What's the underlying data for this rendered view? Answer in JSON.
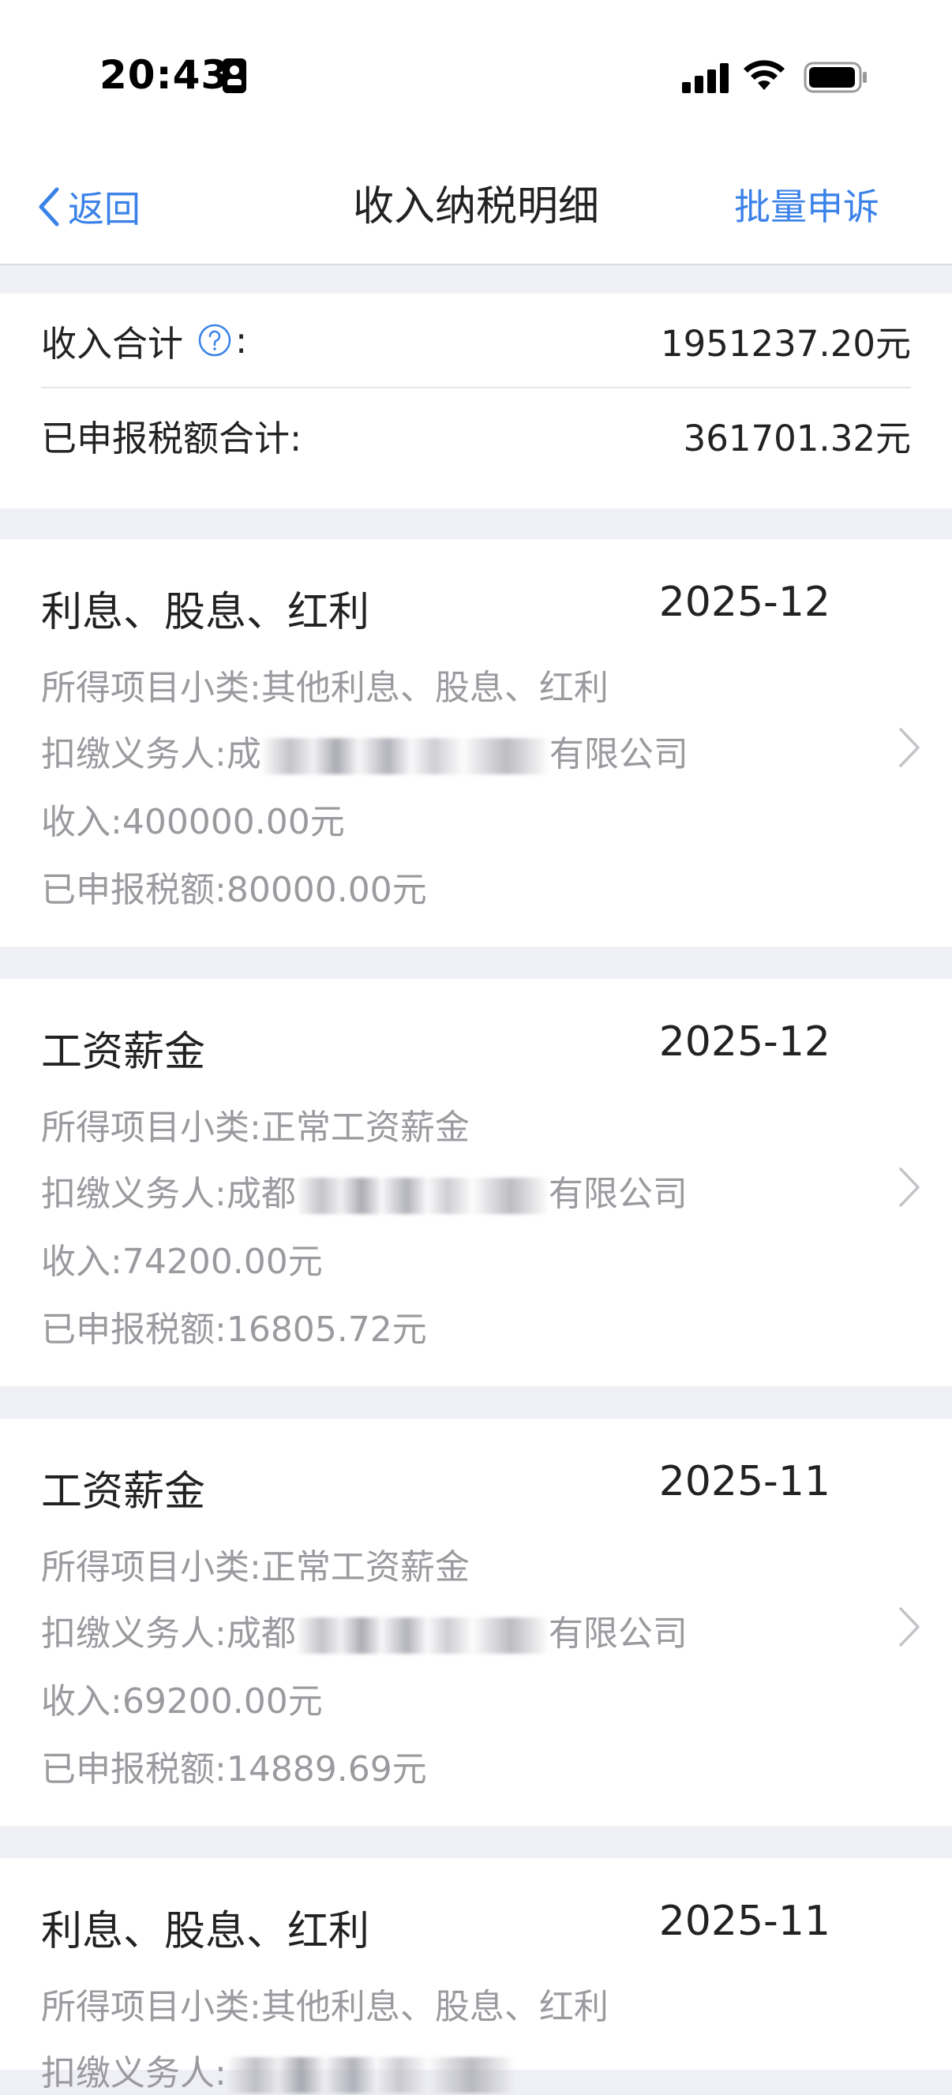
{
  "status_bar": {
    "time": "20:43"
  },
  "nav": {
    "back_label": "返回",
    "title": "收入纳税明细",
    "action_label": "批量申诉"
  },
  "summary": {
    "income_label": "收入合计",
    "colon": ":",
    "income_value": "1951237.20元",
    "tax_label": "已申报税额合计:",
    "tax_value": "361701.32元"
  },
  "records": [
    {
      "title": "利息、股息、红利",
      "period": "2025-12",
      "subcategory_label": "所得项目小类:",
      "subcategory": "其他利息、股息、红利",
      "withholder_label": "扣缴义务人:",
      "withholder_start": "成",
      "withholder_end": "有限公司",
      "income_label": "收入:",
      "income": "400000.00元",
      "tax_label": "已申报税额:",
      "tax": "80000.00元"
    },
    {
      "title": "工资薪金",
      "period": "2025-12",
      "subcategory_label": "所得项目小类:",
      "subcategory": "正常工资薪金",
      "withholder_label": "扣缴义务人:",
      "withholder_start": "成都",
      "withholder_end": "有限公司",
      "income_label": "收入:",
      "income": "74200.00元",
      "tax_label": "已申报税额:",
      "tax": "16805.72元"
    },
    {
      "title": "工资薪金",
      "period": "2025-11",
      "subcategory_label": "所得项目小类:",
      "subcategory": "正常工资薪金",
      "withholder_label": "扣缴义务人:",
      "withholder_start": "成都",
      "withholder_end": "有限公司",
      "income_label": "收入:",
      "income": "69200.00元",
      "tax_label": "已申报税额:",
      "tax": "14889.69元"
    },
    {
      "title": "利息、股息、红利",
      "period": "2025-11",
      "subcategory_label": "所得项目小类:",
      "subcategory": "其他利息、股息、红利",
      "withholder_label": "扣缴义务人:"
    }
  ],
  "colors": {
    "accent": "#3b82e8",
    "text_primary": "#222222",
    "text_secondary": "#9a9a9f",
    "background": "#eff0f5"
  }
}
